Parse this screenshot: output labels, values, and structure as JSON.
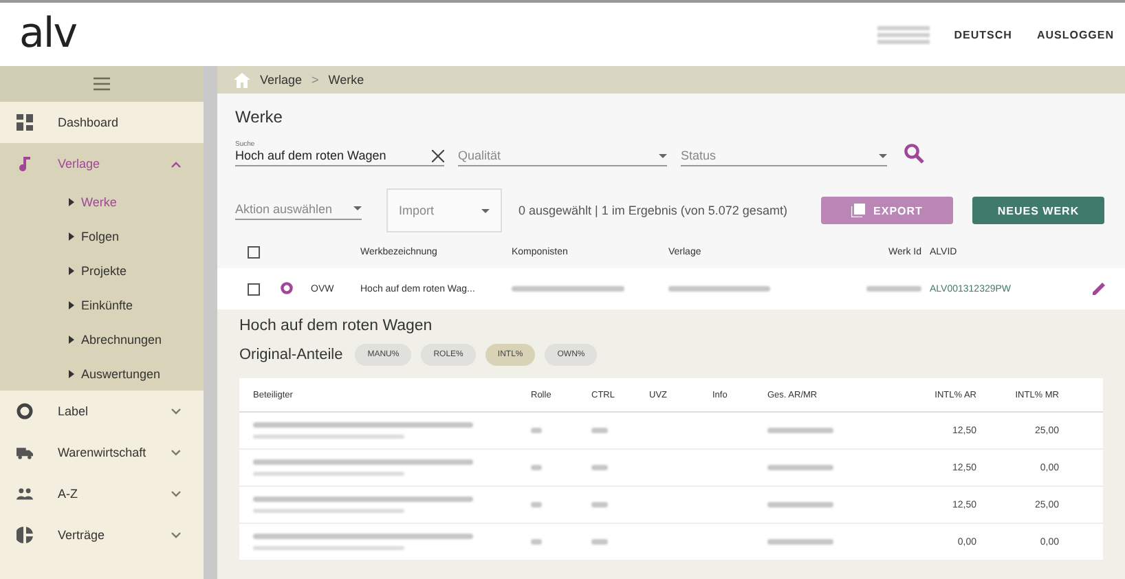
{
  "header": {
    "logo": "alv",
    "language": "DEUTSCH",
    "logout": "AUSLOGGEN"
  },
  "sidebar": {
    "items": [
      {
        "label": "Dashboard",
        "selected": false,
        "expanded": false,
        "expandable": false
      },
      {
        "label": "Verlage",
        "selected": true,
        "expanded": true,
        "expandable": true,
        "children": [
          {
            "label": "Werke",
            "selected": true
          },
          {
            "label": "Folgen",
            "selected": false
          },
          {
            "label": "Projekte",
            "selected": false
          },
          {
            "label": "Einkünfte",
            "selected": false
          },
          {
            "label": "Abrechnungen",
            "selected": false
          },
          {
            "label": "Auswertungen",
            "selected": false
          }
        ]
      },
      {
        "label": "Label",
        "selected": false,
        "expanded": false,
        "expandable": true
      },
      {
        "label": "Warenwirtschaft",
        "selected": false,
        "expanded": false,
        "expandable": true
      },
      {
        "label": "A-Z",
        "selected": false,
        "expanded": false,
        "expandable": true
      },
      {
        "label": "Verträge",
        "selected": false,
        "expanded": false,
        "expandable": true
      }
    ]
  },
  "breadcrumb": {
    "items": [
      "Verlage",
      "Werke"
    ],
    "separator": ">"
  },
  "page_title": "Werke",
  "filters": {
    "search": {
      "label": "Suche",
      "value": "Hoch auf dem roten Wagen"
    },
    "quality": {
      "placeholder": "Qualität"
    },
    "status": {
      "placeholder": "Status"
    }
  },
  "actions": {
    "action_select": {
      "placeholder": "Aktion auswählen"
    },
    "import_select": {
      "placeholder": "Import"
    },
    "summary": "0 ausgewählt | 1 im Ergebnis (von 5.072 gesamt)",
    "export": "EXPORT",
    "new": "NEUES WERK"
  },
  "table": {
    "select_all_checked": false,
    "columns": [
      "Werkbezeichnung",
      "Komponisten",
      "Verlage",
      "Werk Id",
      "ALVID"
    ],
    "rows": [
      {
        "checked": false,
        "type": "OVW",
        "title": "Hoch auf dem roten Wag...",
        "alvid": "ALV001312329PW"
      }
    ]
  },
  "detail": {
    "title": "Hoch auf dem roten Wagen",
    "subtitle": "Original-Anteile",
    "chips": [
      {
        "label": "MANU%",
        "selected": false
      },
      {
        "label": "ROLE%",
        "selected": false
      },
      {
        "label": "INTL%",
        "selected": true
      },
      {
        "label": "OWN%",
        "selected": false
      }
    ],
    "columns": [
      "Beteiligter",
      "Rolle",
      "CTRL",
      "UVZ",
      "Info",
      "Ges. AR/MR",
      "INTL% AR",
      "INTL% MR"
    ],
    "rows": [
      {
        "intl_ar": "12,50",
        "intl_mr": "25,00"
      },
      {
        "intl_ar": "12,50",
        "intl_mr": "0,00"
      },
      {
        "intl_ar": "12,50",
        "intl_mr": "25,00"
      },
      {
        "intl_ar": "0,00",
        "intl_mr": "0,00"
      }
    ]
  }
}
